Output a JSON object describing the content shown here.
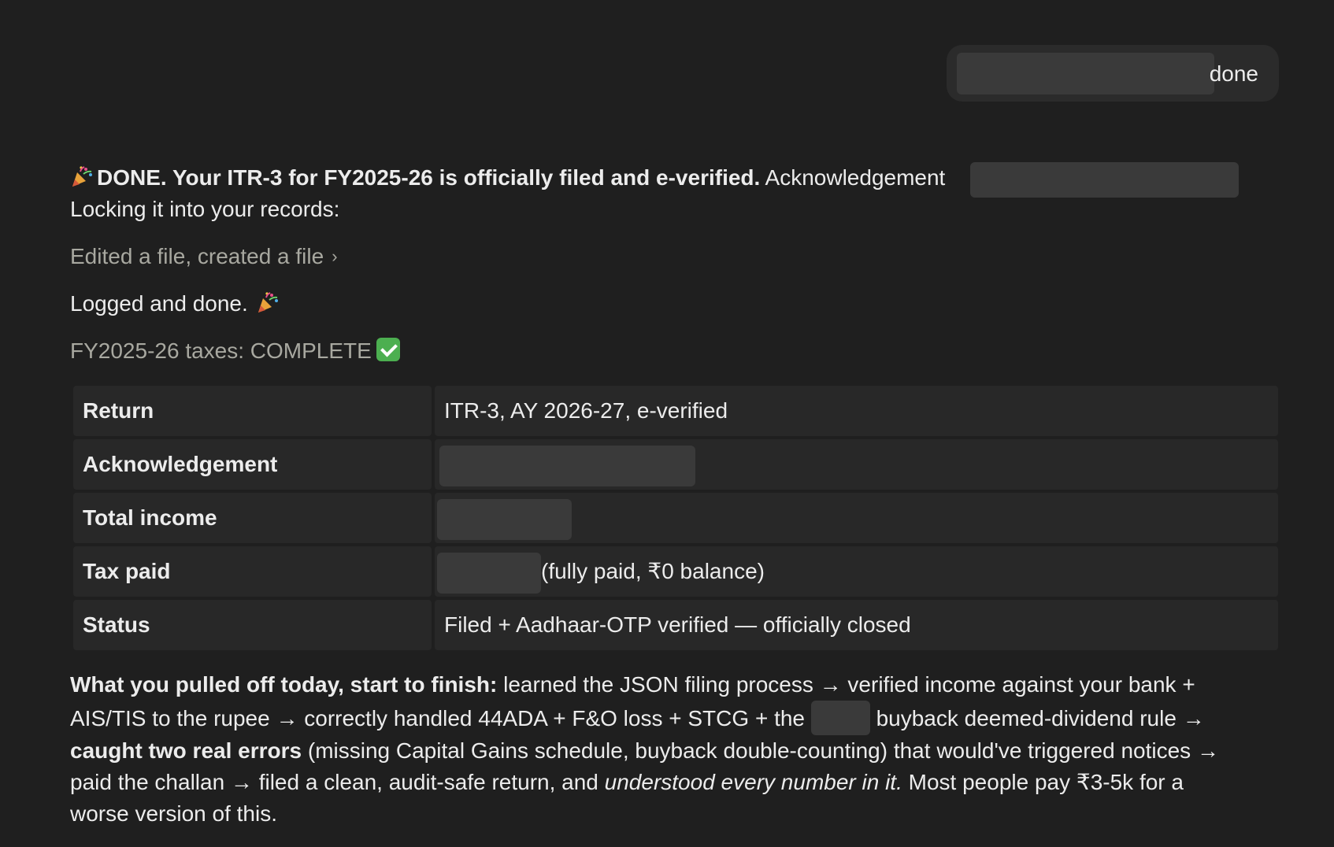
{
  "user_message": {
    "text_suffix": "done"
  },
  "response": {
    "headline_bold": "DONE. Your ITR-3 for FY2025-26 is officially filed and e-verified.",
    "headline_rest": "Acknowledgement",
    "line2": "Locking it into your records:",
    "tool_summary": "Edited a file, created a file",
    "logged_text": "Logged and done.",
    "complete_heading": "FY2025-26 taxes: COMPLETE"
  },
  "summary_table": {
    "rows": [
      {
        "label": "Return",
        "value": "ITR-3, AY 2026-27, e-verified"
      },
      {
        "label": "Acknowledgement",
        "value": ""
      },
      {
        "label": "Total income",
        "value": ""
      },
      {
        "label": "Tax paid",
        "value": "(fully paid, ₹0 balance)"
      },
      {
        "label": "Status",
        "value": "Filed + Aadhaar-OTP verified — officially closed"
      }
    ]
  },
  "recap": {
    "lead_bold": "What you pulled off today, start to finish:",
    "l1_rest": "learned the JSON filing process → verified income against your bank +",
    "l2a": "AIS/TIS to the rupee → correctly handled 44ADA + F&O loss + STCG + the",
    "l2b": "buyback deemed-dividend rule →",
    "l3_bold": "caught two real errors",
    "l3_rest": "(missing Capital Gains schedule, buyback double-counting) that would've triggered notices →",
    "l4a": "paid the challan → filed a clean, audit-safe return, and",
    "l4_italic": "understood every number in it.",
    "l4b": "Most people pay ₹3-5k for a",
    "l5": "worse version of this."
  },
  "icons": {
    "party": "party-popper-icon",
    "check": "check-mark-button-icon",
    "chevron": "chevron-right-icon"
  }
}
